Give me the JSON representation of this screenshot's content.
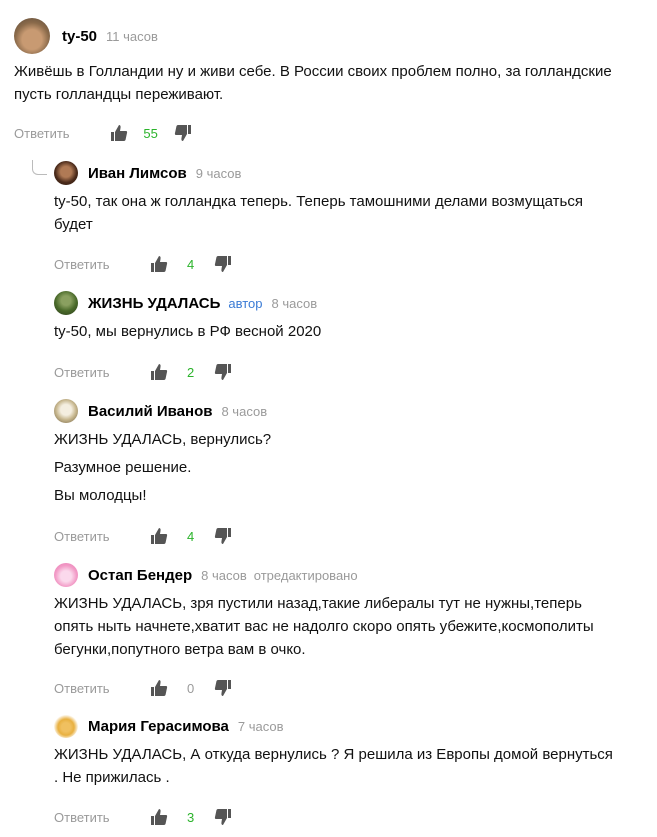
{
  "reply_label": "Ответить",
  "comments": [
    {
      "author": "ty-50",
      "time": "11 часов",
      "text": [
        "Живёшь в Голландии ну и живи себе. В России своих проблем полно, за голландские пусть голландцы переживают."
      ],
      "likes": "55",
      "avatar": "dog-avatar"
    },
    {
      "author": "Иван Лимсов",
      "time": "9 часов",
      "text": [
        "ty-50, так она ж голландка теперь. Теперь тамошними делами возмущаться будет"
      ],
      "likes": "4",
      "avatar": "portrait-avatar"
    },
    {
      "author": "ЖИЗНЬ УДАЛАСЬ",
      "badge": "автор",
      "time": "8 часов",
      "text": [
        "ty-50, мы вернулись в РФ весной 2020"
      ],
      "likes": "2",
      "avatar": "garden-avatar"
    },
    {
      "author": "Василий Иванов",
      "time": "8 часов",
      "text": [
        "ЖИЗНЬ УДАЛАСЬ, вернулись?",
        "Разумное решение.",
        "Вы молодцы!"
      ],
      "likes": "4",
      "avatar": "mask-avatar"
    },
    {
      "author": "Остап Бендер",
      "time": "8 часов",
      "edited": "отредактировано",
      "text": [
        "ЖИЗНЬ УДАЛАСЬ, зря пустили назад,такие либералы тут не нужны,теперь опять ныть начнете,хватит вас не надолго скоро опять убежите,космополиты бегунки,попутного ветра вам в очко."
      ],
      "likes": "0",
      "avatar": "monkey-avatar"
    },
    {
      "author": "Мария Герасимова",
      "time": "7 часов",
      "text": [
        "ЖИЗНЬ УДАЛАСЬ, А откуда вернулись ? Я решила из Европы домой вернуться . Не прижилась ."
      ],
      "likes": "3",
      "avatar": "flame-avatar"
    }
  ],
  "colors": {
    "likes": "#2bb32b",
    "muted": "#9a9a9a",
    "badge": "#3a7bd5"
  }
}
